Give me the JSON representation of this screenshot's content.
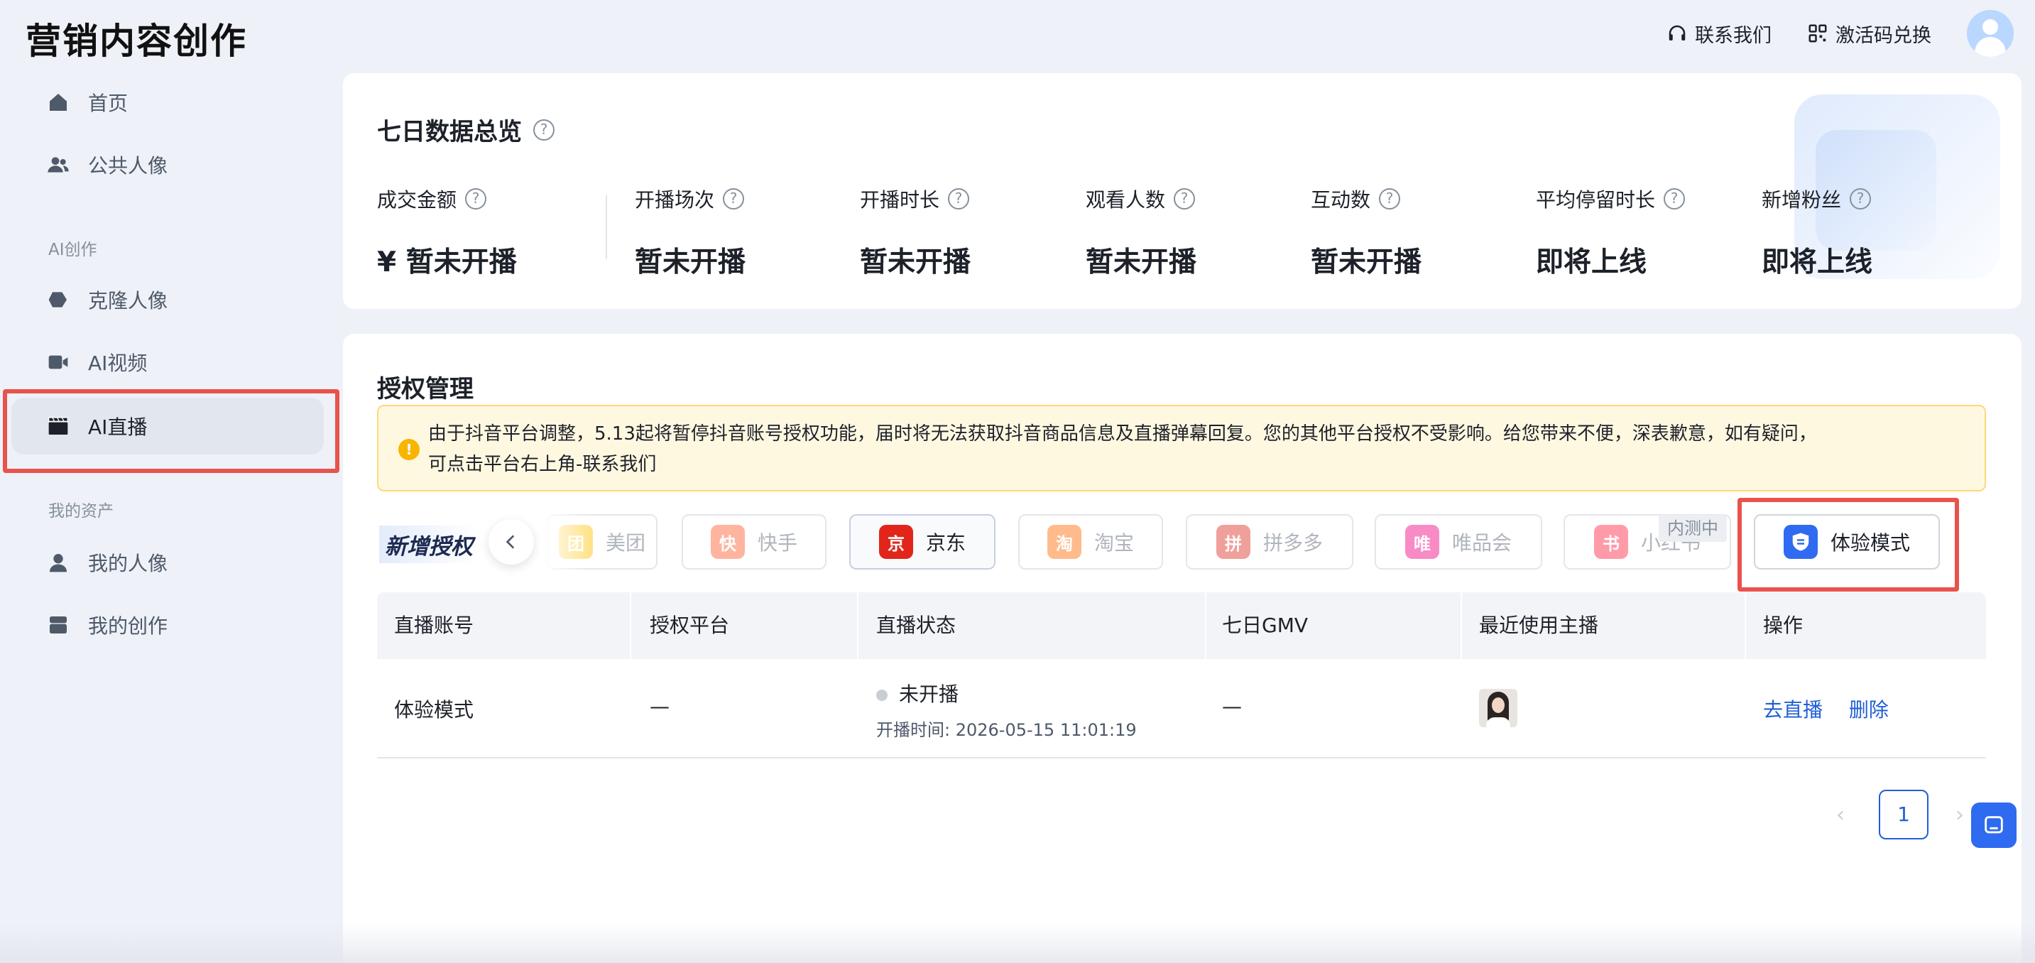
{
  "app": {
    "title": "营销内容创作"
  },
  "header": {
    "contact_label": "联系我们",
    "redeem_label": "激活码兑换"
  },
  "sidebar": {
    "items": [
      {
        "label": "首页",
        "icon": "home-icon"
      },
      {
        "label": "公共人像",
        "icon": "users-icon"
      },
      {
        "label": "克隆人像",
        "icon": "clone-icon"
      },
      {
        "label": "AI视频",
        "icon": "video-icon"
      },
      {
        "label": "AI直播",
        "icon": "live-icon",
        "active": true
      },
      {
        "label": "我的人像",
        "icon": "user-icon"
      },
      {
        "label": "我的创作",
        "icon": "box-icon"
      }
    ],
    "sections": [
      "AI创作",
      "我的资产"
    ]
  },
  "overview": {
    "title": "七日数据总览",
    "metrics": [
      {
        "label": "成交金额",
        "value": "¥ 暂未开播"
      },
      {
        "label": "开播场次",
        "value": "暂未开播"
      },
      {
        "label": "开播时长",
        "value": "暂未开播"
      },
      {
        "label": "观看人数",
        "value": "暂未开播"
      },
      {
        "label": "互动数",
        "value": "暂未开播"
      },
      {
        "label": "平均停留时长",
        "value": "即将上线"
      },
      {
        "label": "新增粉丝",
        "value": "即将上线"
      }
    ]
  },
  "auth": {
    "title": "授权管理",
    "notice_line1": "由于抖音平台调整，5.13起将暂停抖音账号授权功能，届时将无法获取抖音商品信息及直播弹幕回复。您的其他平台授权不受影响。给您带来不便，深表歉意，如有疑问，",
    "notice_line2": "可点击平台右上角-联系我们",
    "new_auth_label": "新增授权",
    "beta_tag": "内测中",
    "platforms": [
      {
        "name": "美团",
        "color": "#ffc300"
      },
      {
        "name": "快手",
        "color": "#ff5a2c"
      },
      {
        "name": "京东",
        "color": "#e1251b"
      },
      {
        "name": "淘宝",
        "color": "#ff6a00"
      },
      {
        "name": "拼多多",
        "color": "#e02e24"
      },
      {
        "name": "唯品会",
        "color": "#f10180"
      },
      {
        "name": "小红书",
        "color": "#ff2442"
      },
      {
        "name": "体验模式",
        "color": "#2f6bf0"
      }
    ],
    "table": {
      "headers": [
        "直播账号",
        "授权平台",
        "直播状态",
        "七日GMV",
        "最近使用主播",
        "操作"
      ],
      "rows": [
        {
          "account": "体验模式",
          "platform": "—",
          "status": "未开播",
          "start_time": "开播时间: 2026-05-15 11:01:19",
          "gmv": "—",
          "actions": [
            "去直播",
            "删除"
          ]
        }
      ]
    },
    "pagination": {
      "current": "1"
    }
  },
  "colors": {
    "accent": "#1f5fd6",
    "highlight": "#e8534d",
    "notice_bg": "#fff8e1"
  }
}
